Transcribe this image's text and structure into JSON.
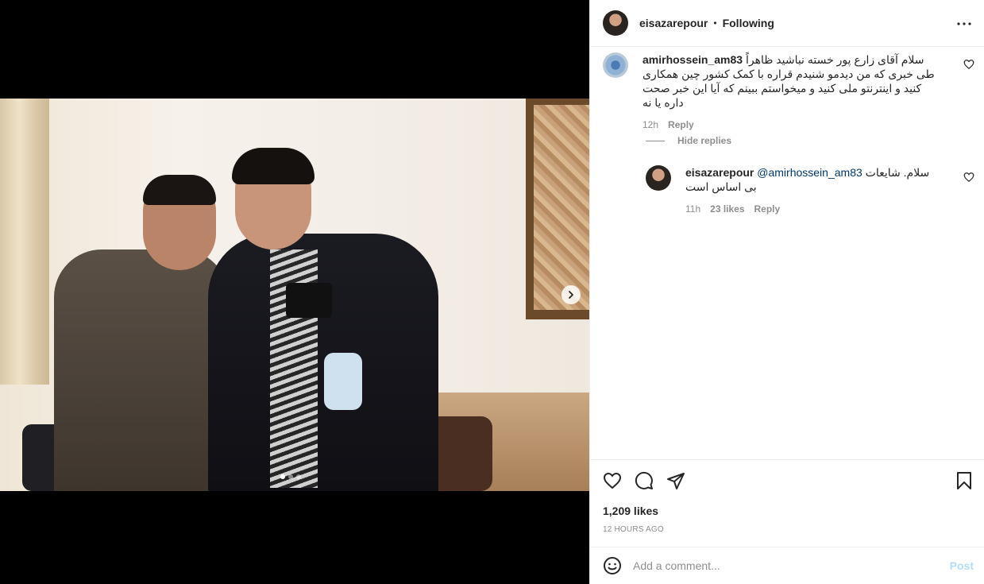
{
  "post": {
    "author": "eisazarepour",
    "follow_status": "Following",
    "separator": "•",
    "carousel": {
      "total": 3,
      "active_index": 0
    }
  },
  "comments": [
    {
      "username": "amirhossein_am83",
      "text": "سلام آقای زارع پور خسته نباشید ظاهراً طی خبری که من دیدمو شنیدم قراره با کمک کشور چین همکاری کنید و اینترنتو ملی کنید و میخواستم ببینم که آیا این خبر صحت داره یا نه",
      "time": "12h",
      "reply_label": "Reply"
    }
  ],
  "replies_toggle": "Hide replies",
  "reply": {
    "username": "eisazarepour",
    "mention": "@amirhossein_am83",
    "text": "سلام. شایعات بی اساس است",
    "time": "11h",
    "likes": "23 likes",
    "reply_label": "Reply"
  },
  "footer": {
    "likes": "1,209 likes",
    "time": "12 HOURS AGO",
    "comment_placeholder": "Add a comment...",
    "post_label": "Post"
  },
  "icons": {
    "more": "more-options-icon",
    "like": "heart-icon",
    "comment": "comment-icon",
    "share": "share-icon",
    "save": "bookmark-icon",
    "emoji": "emoji-icon",
    "next": "chevron-right-icon"
  },
  "colors": {
    "text": "#262626",
    "secondary": "#8e8e8e",
    "link": "#00376b",
    "post_disabled": "#b2dffc"
  }
}
